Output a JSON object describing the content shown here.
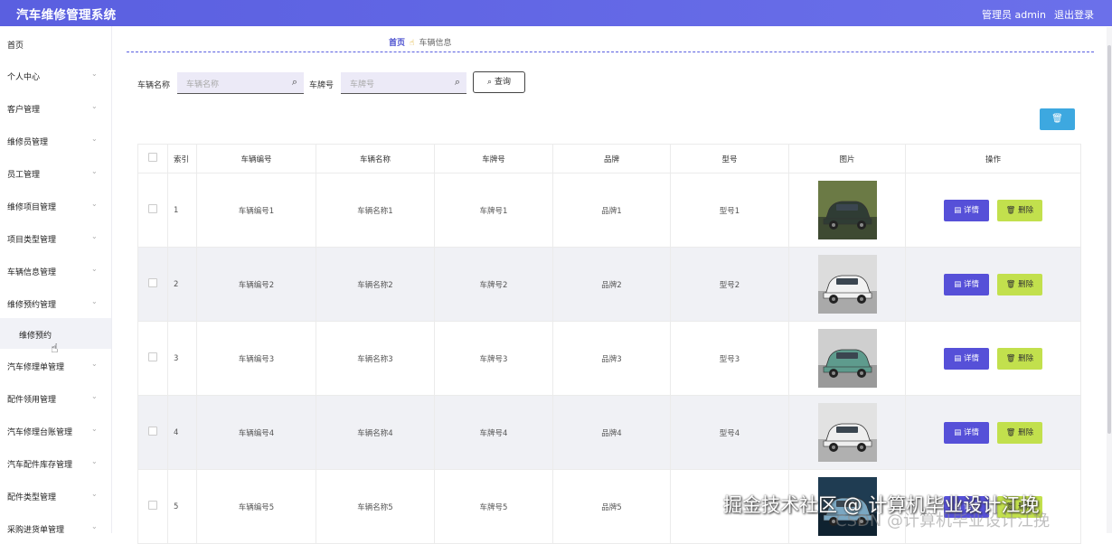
{
  "header": {
    "title": "汽车维修管理系统",
    "user": "管理员 admin",
    "logout": "退出登录"
  },
  "sidebar": {
    "items": [
      {
        "label": "首页",
        "chevron": false
      },
      {
        "label": "个人中心",
        "chevron": true
      },
      {
        "label": "客户管理",
        "chevron": true
      },
      {
        "label": "维修员管理",
        "chevron": true
      },
      {
        "label": "员工管理",
        "chevron": true
      },
      {
        "label": "维修项目管理",
        "chevron": true
      },
      {
        "label": "项目类型管理",
        "chevron": true
      },
      {
        "label": "车辆信息管理",
        "chevron": true
      },
      {
        "label": "维修预约管理",
        "chevron": true
      },
      {
        "label": "维修预约",
        "chevron": false,
        "sub": true
      },
      {
        "label": "汽车修理单管理",
        "chevron": true
      },
      {
        "label": "配件领用管理",
        "chevron": true
      },
      {
        "label": "汽车修理台账管理",
        "chevron": true
      },
      {
        "label": "汽车配件库存管理",
        "chevron": true
      },
      {
        "label": "配件类型管理",
        "chevron": true
      },
      {
        "label": "采购进货单管理",
        "chevron": true
      }
    ]
  },
  "breadcrumb": {
    "home": "首页",
    "current": "车辆信息"
  },
  "search": {
    "name_label": "车辆名称",
    "name_placeholder": "车辆名称",
    "plate_label": "车牌号",
    "plate_placeholder": "车牌号",
    "query_label": "查询"
  },
  "table": {
    "headers": [
      "索引",
      "车辆编号",
      "车辆名称",
      "车牌号",
      "品牌",
      "型号",
      "图片",
      "操作"
    ],
    "rows": [
      {
        "index": "1",
        "code": "车辆编号1",
        "name": "车辆名称1",
        "plate": "车牌号1",
        "brand": "品牌1",
        "model": "型号1",
        "image": "dark-green-suv"
      },
      {
        "index": "2",
        "code": "车辆编号2",
        "name": "车辆名称2",
        "plate": "车牌号2",
        "brand": "品牌2",
        "model": "型号2",
        "image": "white-suv"
      },
      {
        "index": "3",
        "code": "车辆编号3",
        "name": "车辆名称3",
        "plate": "车牌号3",
        "brand": "品牌3",
        "model": "型号3",
        "image": "teal-compact-car"
      },
      {
        "index": "4",
        "code": "车辆编号4",
        "name": "车辆名称4",
        "plate": "车牌号4",
        "brand": "品牌4",
        "model": "型号4",
        "image": "white-compact-suv"
      },
      {
        "index": "5",
        "code": "车辆编号5",
        "name": "车辆名称5",
        "plate": "车牌号5",
        "brand": "品牌5",
        "model": "",
        "image": "car-in-garage"
      }
    ],
    "detail_label": "详情",
    "delete_label": "删除"
  },
  "watermark": {
    "text": "掘金技术社区 @ 计算机毕业设计江挽",
    "ghost": "CSDN @计算机毕业设计江挽"
  },
  "colors": {
    "header": "#5a5fe0",
    "detail": "#5650d8",
    "delete": "#c2e04d",
    "batch_delete": "#3da8e0",
    "alt_row": "#f0f1f5"
  }
}
